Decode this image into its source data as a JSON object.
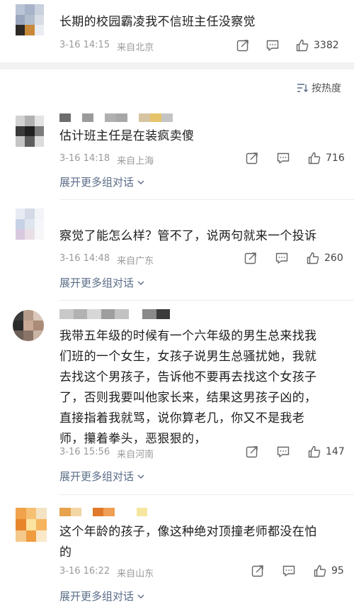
{
  "post": {
    "text": "长期的校园霸凌我不信班主任没察觉",
    "time": "3-16 14:15",
    "location": "来自北京",
    "likes": "3382"
  },
  "sort": {
    "label": "按热度"
  },
  "comments": [
    {
      "text": "估计班主任是在装疯卖傻",
      "time": "3-16 14:18",
      "location": "来自上海",
      "likes": "716",
      "expand": "展开更多组对话"
    },
    {
      "text": "察觉了能怎么样？管不了，说两句就来一个投诉",
      "time": "3-16 14:48",
      "location": "来自广东",
      "likes": "260",
      "expand": "展开更多组对话"
    },
    {
      "lines": [
        "我带五年级的时候有一个六年级的男生总来找我",
        "们班的一个女生，女孩子说男生总骚扰她，我就",
        "去找这个男孩子，告诉他不要再去找这个女孩子",
        "了，否则我要叫他家长来，结果这男孩子凶的，",
        "直接指着我就骂，说你算老几，你又不是我老",
        "师，攥着拳头，恶狠狠的，"
      ],
      "time": "3-16 15:56",
      "location": "来自河南",
      "likes": "147",
      "expand": "展开更多组对话"
    },
    {
      "lines": [
        "这个年龄的孩子，像这种绝对顶撞老师都没在怕",
        "的"
      ],
      "time": "3-16 16:22",
      "location": "来自山东",
      "likes": "95",
      "expand": "展开更多组对话"
    }
  ],
  "colors": {
    "link": "#5a6d88",
    "meta": "#9a9a9a",
    "separator": "#f2f2f2"
  }
}
